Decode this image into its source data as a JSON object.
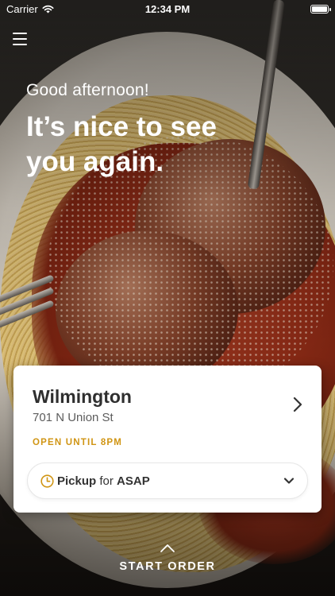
{
  "status_bar": {
    "carrier": "Carrier",
    "time": "12:34 PM",
    "icons": [
      "wifi-icon",
      "battery-icon"
    ]
  },
  "header": {
    "menu_icon": "hamburger-menu-icon"
  },
  "hero": {
    "greeting": "Good afternoon!",
    "headline": "It’s nice to see you again."
  },
  "location_card": {
    "name": "Wilmington",
    "address": "701 N Union St",
    "hours": "OPEN UNTIL 8PM",
    "hours_color": "#D09514",
    "order_type": "Pickup",
    "for_text": "for",
    "time_choice": "ASAP",
    "icons": [
      "chevron-right-icon",
      "clock-icon",
      "chevron-down-icon"
    ]
  },
  "footer": {
    "start_order": "START ORDER",
    "icon": "chevron-up-icon"
  }
}
